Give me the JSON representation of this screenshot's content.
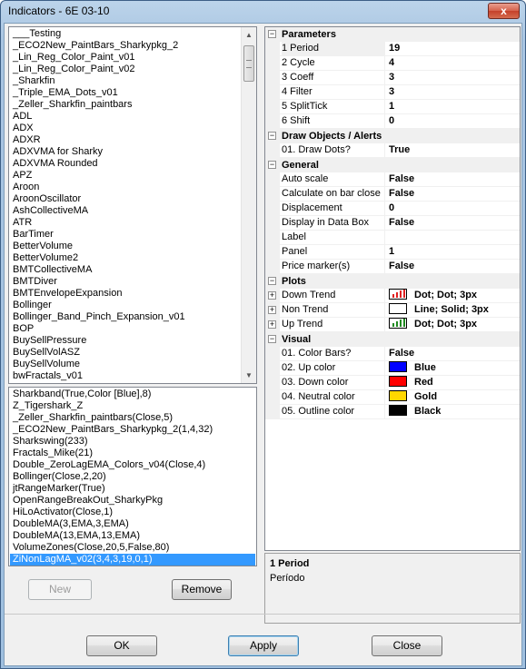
{
  "window": {
    "title": "Indicators - 6E 03-10",
    "close_glyph": "x"
  },
  "available_list": {
    "items": [
      "___Testing",
      "_ECO2New_PaintBars_Sharkypkg_2",
      "_Lin_Reg_Color_Paint_v01",
      "_Lin_Reg_Color_Paint_v02",
      "_Sharkfin",
      "_Triple_EMA_Dots_v01",
      "_Zeller_Sharkfin_paintbars",
      "ADL",
      "ADX",
      "ADXR",
      "ADXVMA for Sharky",
      "ADXVMA Rounded",
      "APZ",
      "Aroon",
      "AroonOscillator",
      "AshCollectiveMA",
      "ATR",
      "BarTimer",
      "BetterVolume",
      "BetterVolume2",
      "BMTCollectiveMA",
      "BMTDiver",
      "BMTEnvelopeExpansion",
      "Bollinger",
      "Bollinger_Band_Pinch_Expansion_v01",
      "BOP",
      "BuySellPressure",
      "BuySellVolASZ",
      "BuySellVolume",
      "bwFractals_v01"
    ]
  },
  "applied_list": {
    "items": [
      "Sharkband(True,Color [Blue],8)",
      "Z_Tigershark_Z",
      "_Zeller_Sharkfin_paintbars(Close,5)",
      "_ECO2New_PaintBars_Sharkypkg_2(1,4,32)",
      "Sharkswing(233)",
      "Fractals_Mike(21)",
      "Double_ZeroLagEMA_Colors_v04(Close,4)",
      "Bollinger(Close,2,20)",
      "jtRangeMarker(True)",
      "OpenRangeBreakOut_SharkyPkg",
      "HiLoActivator(Close,1)",
      "DoubleMA(3,EMA,3,EMA)",
      "DoubleMA(13,EMA,13,EMA)",
      "VolumeZones(Close,20,5,False,80)",
      "ZiNonLagMA_v02(3,4,3,19,0,1)"
    ],
    "selected_index": 14
  },
  "buttons": {
    "new": "New",
    "remove": "Remove",
    "ok": "OK",
    "apply": "Apply",
    "close": "Close"
  },
  "property_grid": {
    "collapse_glyph": "−",
    "expand_glyph": "+",
    "categories": [
      {
        "name": "Parameters",
        "rows": [
          {
            "name": "1 Period",
            "value": "19",
            "highlight": true
          },
          {
            "name": "2 Cycle",
            "value": "4"
          },
          {
            "name": "3 Coeff",
            "value": "3"
          },
          {
            "name": "4 Filter",
            "value": "3"
          },
          {
            "name": "5 SplitTick",
            "value": "1"
          },
          {
            "name": "6 Shift",
            "value": "0"
          }
        ]
      },
      {
        "name": "Draw Objects / Alerts",
        "rows": [
          {
            "name": "01. Draw Dots?",
            "value": "True"
          }
        ]
      },
      {
        "name": "General",
        "rows": [
          {
            "name": "Auto scale",
            "value": "False"
          },
          {
            "name": "Calculate on bar close",
            "value": "False"
          },
          {
            "name": "Displacement",
            "value": "0"
          },
          {
            "name": "Display in Data Box",
            "value": "False"
          },
          {
            "name": "Label",
            "value": ""
          },
          {
            "name": "Panel",
            "value": "1"
          },
          {
            "name": "Price marker(s)",
            "value": "False"
          }
        ]
      },
      {
        "name": "Plots",
        "rows": [
          {
            "name": "Down Trend",
            "value": "Dot; Dot; 3px",
            "plot": "bars",
            "plot_color": "#e02020",
            "expandable": true
          },
          {
            "name": "Non Trend",
            "value": "Line; Solid; 3px",
            "plot": "none",
            "plot_color": "#ffffff",
            "expandable": true
          },
          {
            "name": "Up Trend",
            "value": "Dot; Dot; 3px",
            "plot": "bars",
            "plot_color": "#1f8a1f",
            "expandable": true
          }
        ]
      },
      {
        "name": "Visual",
        "rows": [
          {
            "name": "01. Color Bars?",
            "value": "False"
          },
          {
            "name": "02. Up color",
            "value": "Blue",
            "swatch": "#0000ff"
          },
          {
            "name": "03. Down color",
            "value": "Red",
            "swatch": "#ff0000"
          },
          {
            "name": "04. Neutral color",
            "value": "Gold",
            "swatch": "#ffd700"
          },
          {
            "name": "05. Outline color",
            "value": "Black",
            "swatch": "#000000"
          }
        ]
      }
    ]
  },
  "description": {
    "title": "1 Period",
    "text": "Período"
  },
  "colors": {
    "selection": "#3399ff",
    "title_blue": "#a9c5e2"
  }
}
